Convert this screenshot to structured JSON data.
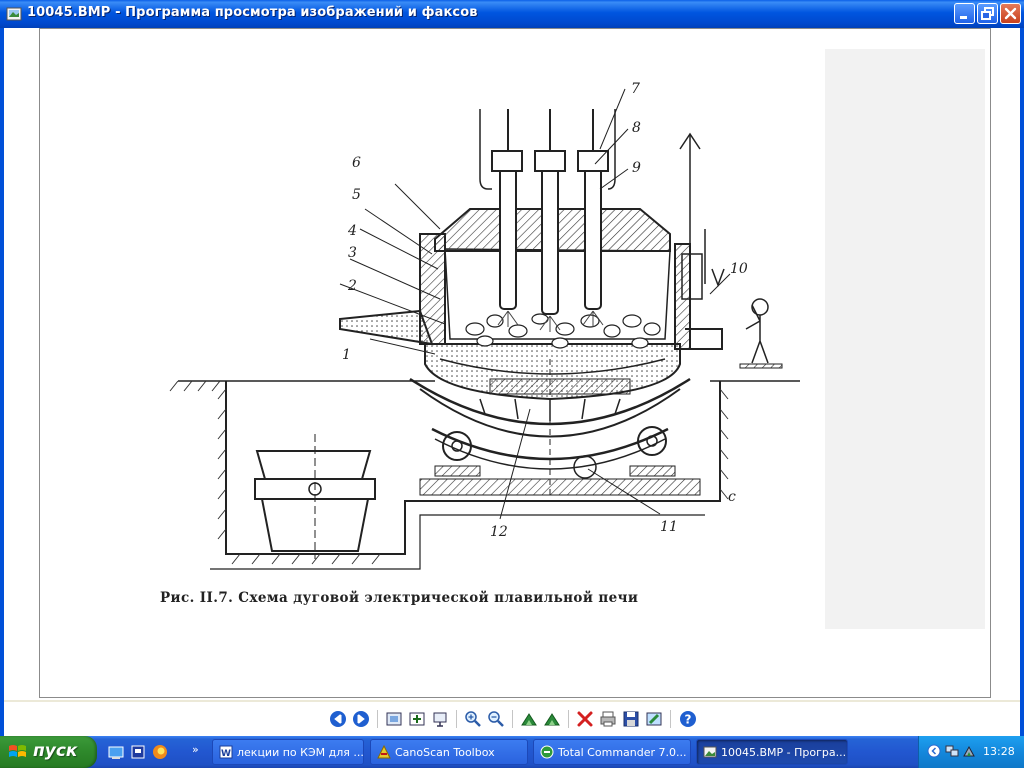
{
  "window": {
    "title": "10045.BMP - Программа просмотра изображений и факсов",
    "icon": "image-viewer-icon",
    "buttons": [
      "minimize-button",
      "maximize-button",
      "close-button"
    ]
  },
  "figure": {
    "caption": "Рис. II.7. Схема дуговой электрической плавильной печи",
    "labels": [
      "1",
      "2",
      "3",
      "4",
      "5",
      "6",
      "7",
      "8",
      "9",
      "10",
      "11",
      "12",
      "c"
    ]
  },
  "viewer_toolbar": {
    "icons": [
      "previous-image-icon",
      "next-image-icon",
      "best-fit-icon",
      "actual-size-icon",
      "slideshow-icon",
      "zoom-in-icon",
      "zoom-out-icon",
      "rotate-clockwise-icon",
      "rotate-counterclockwise-icon",
      "delete-icon",
      "print-icon",
      "save-icon",
      "edit-icon",
      "help-icon"
    ]
  },
  "taskbar": {
    "start_label": "пуск",
    "chevron": "»",
    "tasks": [
      {
        "label": "лекции по КЭМ для ...",
        "icon": "word-document-icon"
      },
      {
        "label": "CanoScan Toolbox",
        "icon": "canoscan-icon"
      },
      {
        "label": "Total Commander 7.0...",
        "icon": "total-commander-icon"
      },
      {
        "label": "10045.BMP - Програ...",
        "icon": "image-viewer-icon",
        "active": true
      }
    ],
    "clock": "13:28"
  },
  "colors": {
    "titlebar": "#0055e0",
    "taskbar": "#2257d0",
    "start_button": "#2f8a2c",
    "tray": "#1488dc"
  }
}
